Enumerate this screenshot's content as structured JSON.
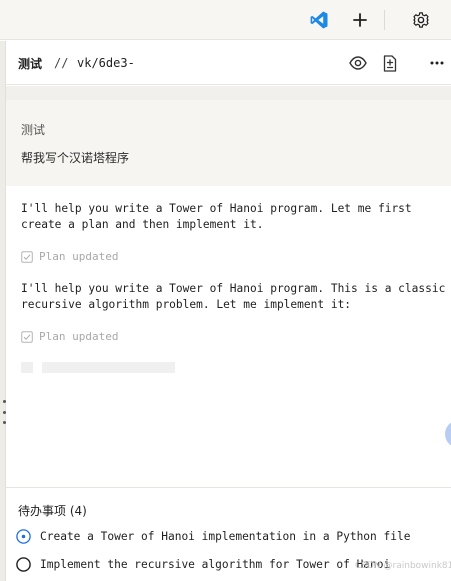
{
  "toolbar": {
    "icons": [
      "vscode-icon",
      "plus-icon",
      "gear-icon"
    ]
  },
  "tab": {
    "title": "测试",
    "separator": "//",
    "path": "vk/6de3-"
  },
  "header_actions": [
    "eye-icon",
    "file-diff-icon",
    "more-icon"
  ],
  "user_message": {
    "label": "测试",
    "text": "帮我写个汉诺塔程序"
  },
  "messages": [
    {
      "text": "I'll help you write a Tower of Hanoi program. Let me first create a plan and then implement it.",
      "status": "Plan updated"
    },
    {
      "text": "I'll help you write a Tower of Hanoi program. This is a classic recursive algorithm problem. Let me implement it:",
      "status": "Plan updated"
    }
  ],
  "todo": {
    "title": "待办事项 (4)",
    "items": [
      {
        "label": "Create a Tower of Hanoi implementation in a Python file",
        "state": "in-progress"
      },
      {
        "label": "Implement the recursive algorithm for Tower of Hanoi",
        "state": "pending"
      }
    ]
  },
  "watermark": "CSDN @rainbowink8163",
  "colors": {
    "accent": "#1f6fe0",
    "vscode_blue": "#1e88e5",
    "muted": "#a8a8a8"
  }
}
